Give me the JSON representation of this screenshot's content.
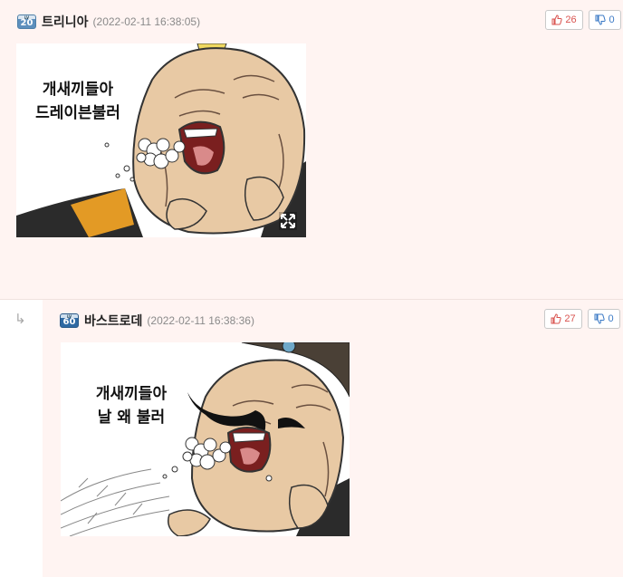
{
  "comments": [
    {
      "level": "20",
      "nick": "트리니아",
      "timestamp": "(2022-02-11 16:38:05)",
      "upvotes": "26",
      "downvotes": "0",
      "image": {
        "line1": "개새끼들아",
        "line2": "드레이븐불러"
      }
    },
    {
      "level": "60",
      "nick": "바스트로데",
      "timestamp": "(2022-02-11 16:38:36)",
      "upvotes": "27",
      "downvotes": "0",
      "image": {
        "line1": "개새끼들아",
        "line2": "날 왜 불러"
      }
    }
  ],
  "icons": {
    "reply": "reply-arrow-icon",
    "up": "thumbs-up-icon",
    "down": "thumbs-down-icon",
    "expand": "expand-icon"
  },
  "colors": {
    "comment_bg": "#fff4f2",
    "up": "#d9534f",
    "down": "#3a79c5"
  }
}
